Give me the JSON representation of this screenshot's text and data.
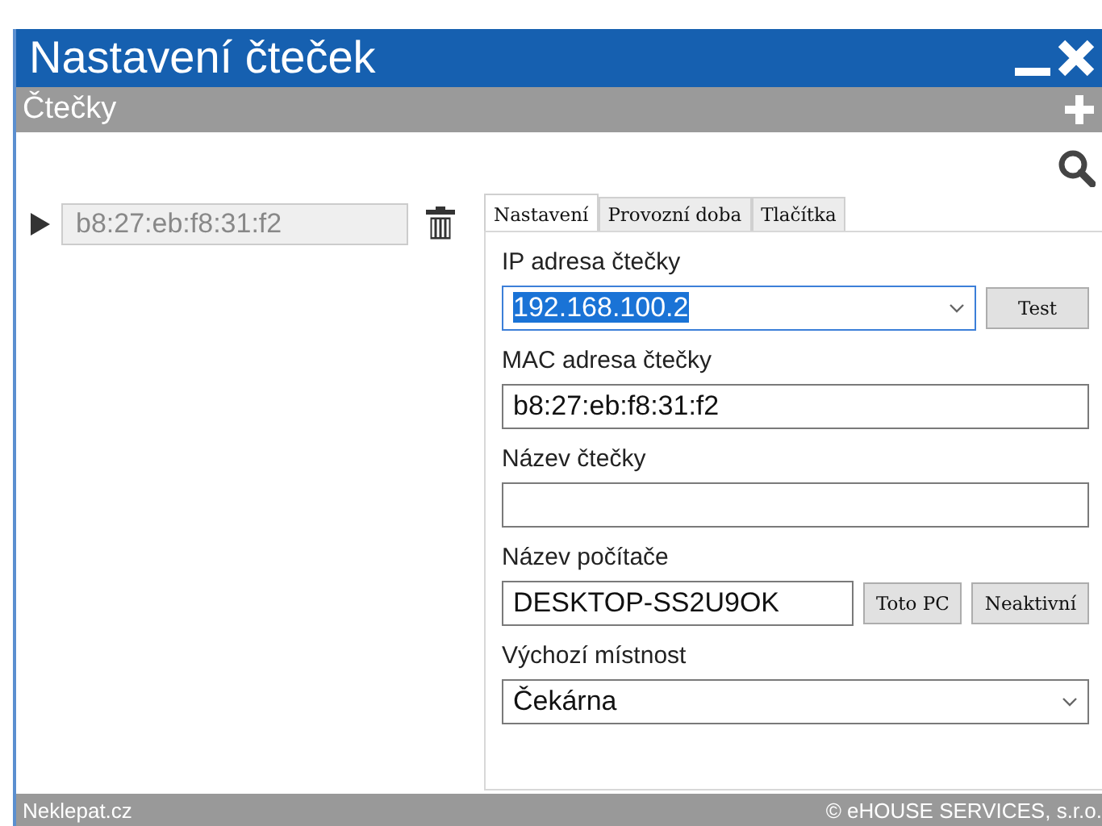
{
  "window": {
    "title": "Nastavení čteček"
  },
  "section": {
    "title": "Čtečky"
  },
  "readers": [
    {
      "mac": "b8:27:eb:f8:31:f2",
      "expanded": false
    }
  ],
  "tabs": [
    {
      "label": "Nastavení",
      "selected": true
    },
    {
      "label": "Provozní doba",
      "selected": false
    },
    {
      "label": "Tlačítka",
      "selected": false
    }
  ],
  "fields": [
    {
      "kind": "combo",
      "label": "IP adresa čtečky",
      "value": "192.168.100.2",
      "highlighted": true,
      "buttons": [
        "Test"
      ]
    },
    {
      "kind": "text",
      "label": "MAC adresa čtečky",
      "value": "b8:27:eb:f8:31:f2"
    },
    {
      "kind": "text",
      "label": "Název čtečky"
    },
    {
      "kind": "text",
      "label": "Název počítače",
      "value": "DESKTOP-SS2U9OK",
      "buttons": [
        "Toto PC",
        "Neaktivní"
      ]
    },
    {
      "kind": "select",
      "label": "Výchozí místnost",
      "value": "Čekárna"
    }
  ],
  "footer": {
    "left": "Neklepat.cz",
    "right": "© eHOUSE SERVICES, s.r.o."
  }
}
